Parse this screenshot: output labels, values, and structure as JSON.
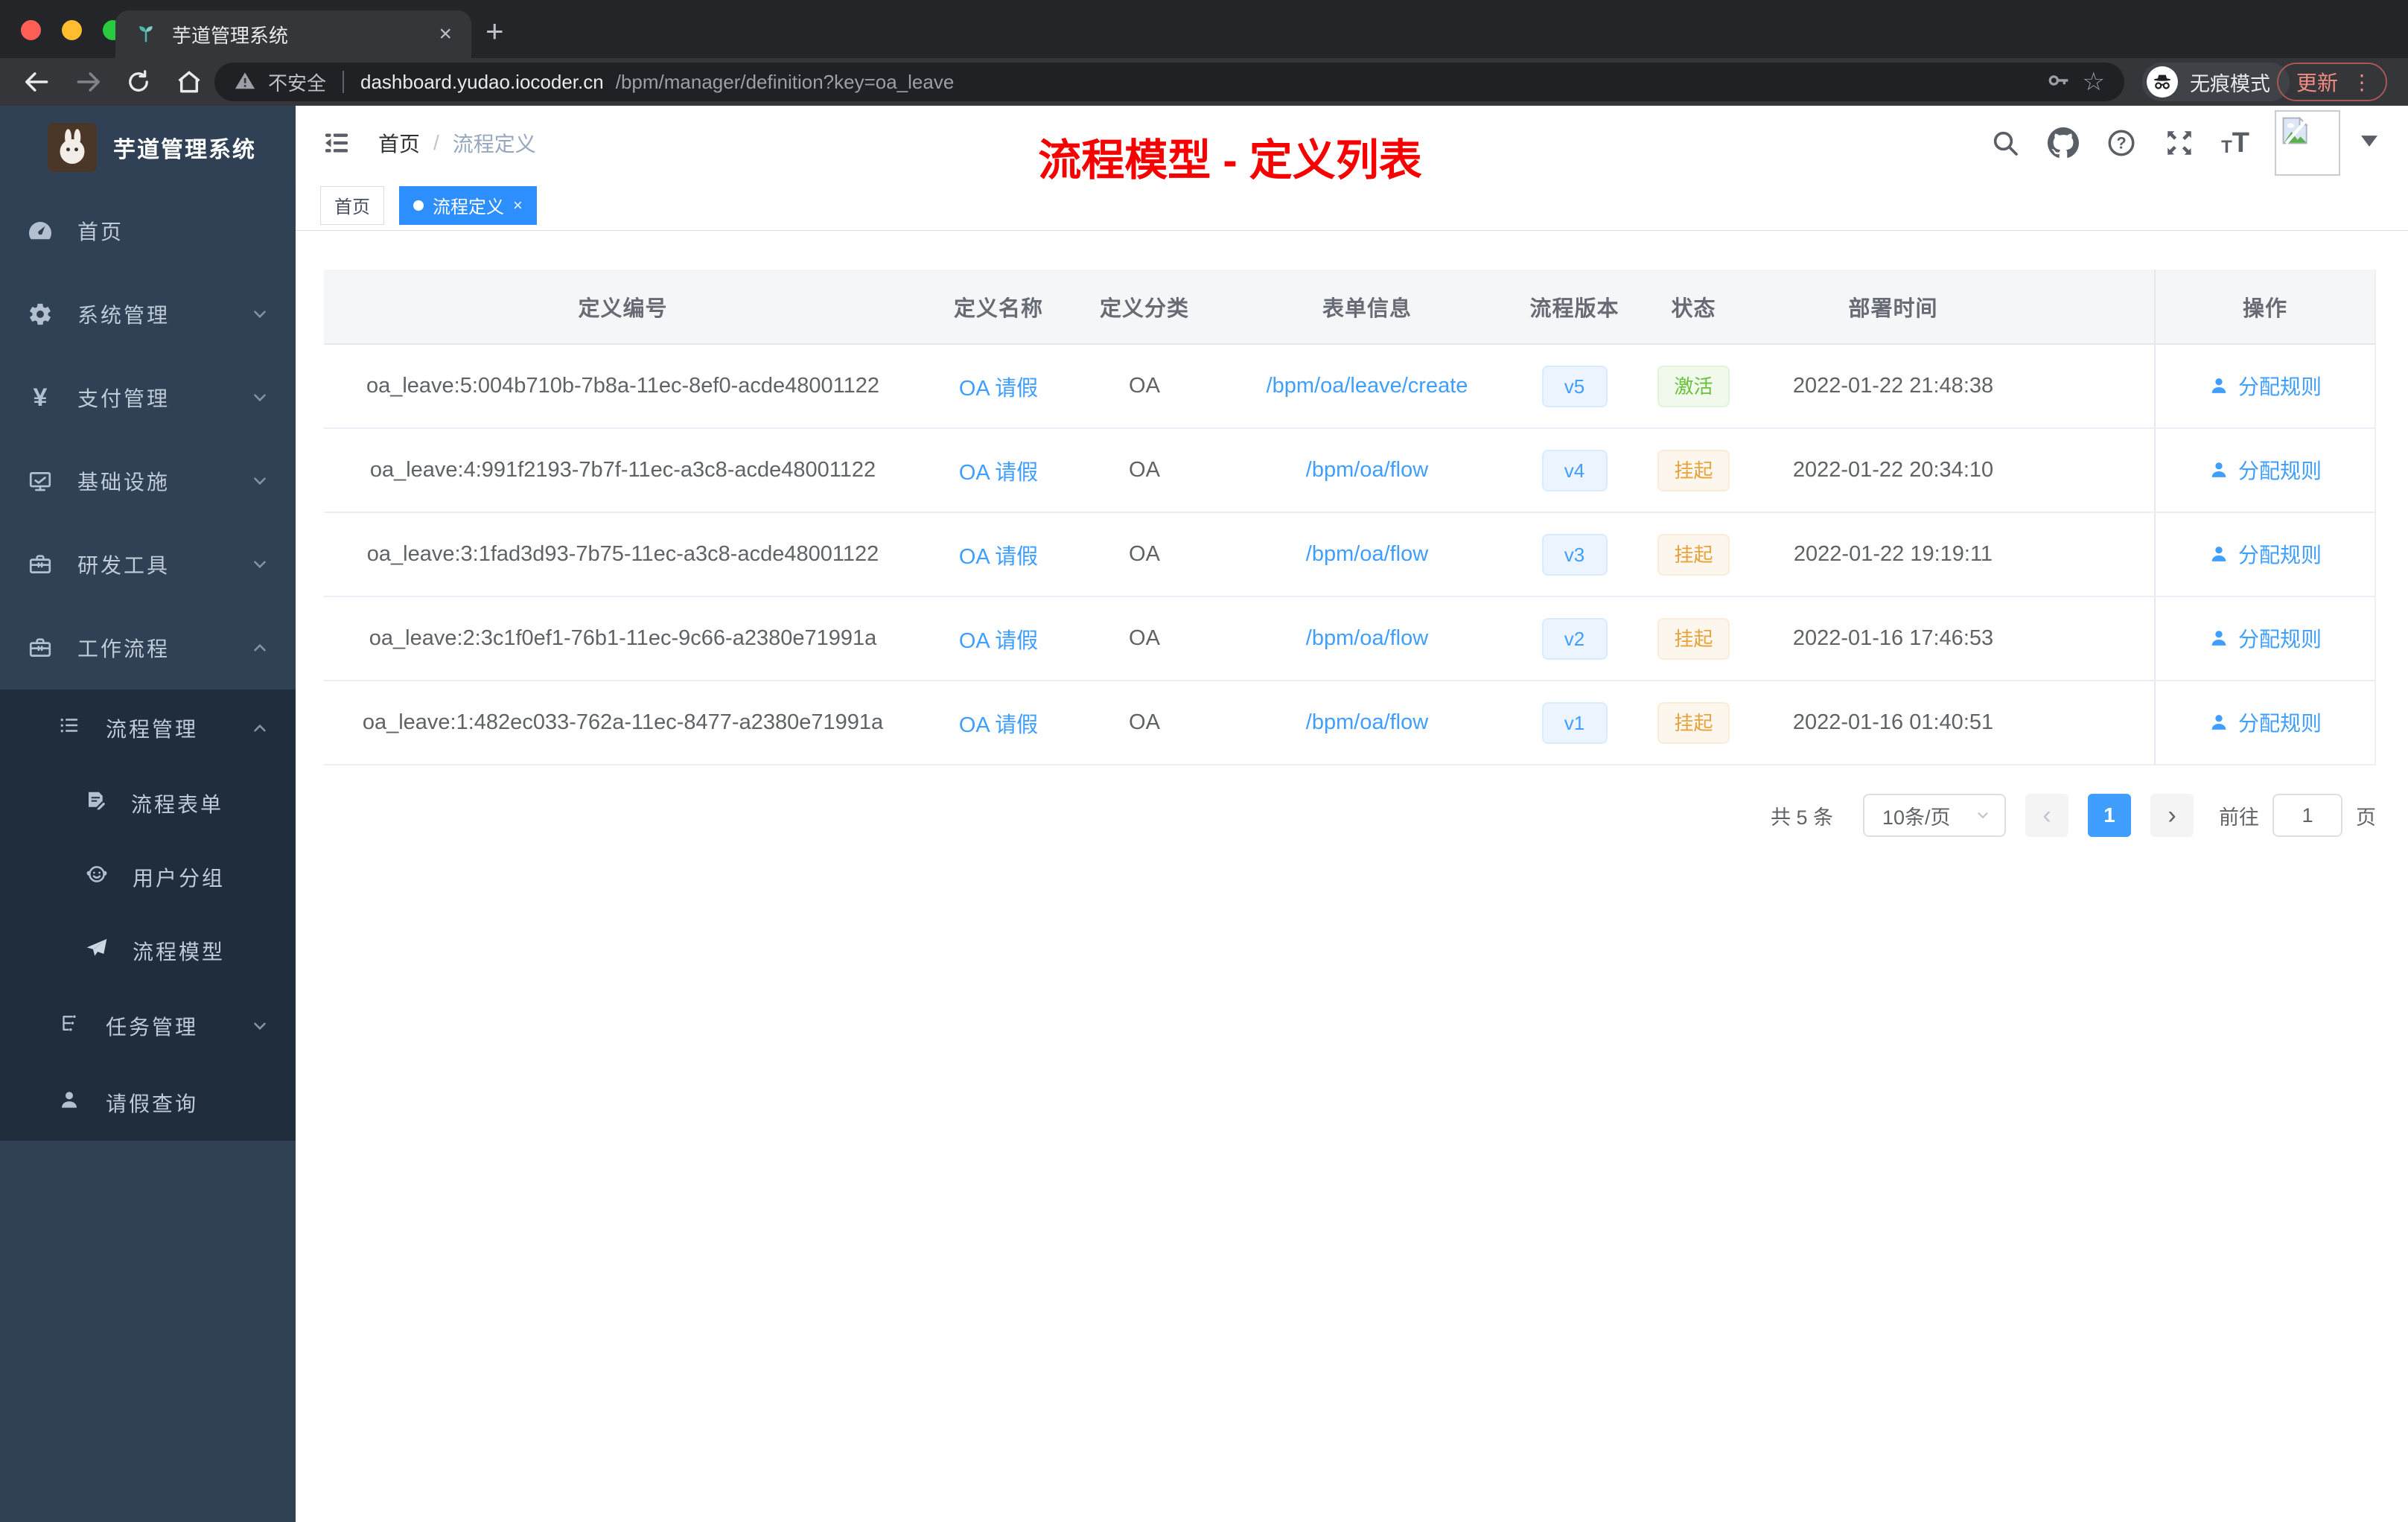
{
  "browser": {
    "tab": {
      "title": "芋道管理系统",
      "close": "×",
      "new_tab": "+"
    },
    "address": {
      "warning": "不安全",
      "host": "dashboard.yudao.iocoder.cn",
      "path": "/bpm/manager/definition?key=oa_leave"
    },
    "incognito_label": "无痕模式",
    "update_label": "更新",
    "menu_dots": "⋮",
    "star": "☆"
  },
  "sidebar": {
    "title": "芋道管理系统",
    "items": [
      {
        "label": "首页"
      },
      {
        "label": "系统管理"
      },
      {
        "label": "支付管理"
      },
      {
        "label": "基础设施"
      },
      {
        "label": "研发工具"
      },
      {
        "label": "工作流程"
      }
    ],
    "submenu": {
      "group": {
        "label": "流程管理"
      },
      "children": [
        {
          "label": "流程表单"
        },
        {
          "label": "用户分组"
        },
        {
          "label": "流程模型"
        }
      ],
      "siblings": [
        {
          "label": "任务管理"
        },
        {
          "label": "请假查询"
        }
      ]
    }
  },
  "header": {
    "breadcrumb": {
      "home": "首页",
      "separator": "/",
      "current": "流程定义"
    },
    "annotation": "流程模型 - 定义列表"
  },
  "tags": {
    "home": "首页",
    "active": "流程定义",
    "close": "×"
  },
  "table": {
    "columns": [
      "定义编号",
      "定义名称",
      "定义分类",
      "表单信息",
      "流程版本",
      "状态",
      "部署时间",
      "操作"
    ],
    "rows": [
      {
        "id": "oa_leave:5:004b710b-7b8a-11ec-8ef0-acde48001122",
        "name": "OA 请假",
        "category": "OA",
        "form": "/bpm/oa/leave/create",
        "version": "v5",
        "status": "激活",
        "status_type": "success",
        "deploy_time": "2022-01-22 21:48:38",
        "action": "分配规则"
      },
      {
        "id": "oa_leave:4:991f2193-7b7f-11ec-a3c8-acde48001122",
        "name": "OA 请假",
        "category": "OA",
        "form": "/bpm/oa/flow",
        "version": "v4",
        "status": "挂起",
        "status_type": "warning",
        "deploy_time": "2022-01-22 20:34:10",
        "action": "分配规则"
      },
      {
        "id": "oa_leave:3:1fad3d93-7b75-11ec-a3c8-acde48001122",
        "name": "OA 请假",
        "category": "OA",
        "form": "/bpm/oa/flow",
        "version": "v3",
        "status": "挂起",
        "status_type": "warning",
        "deploy_time": "2022-01-22 19:19:11",
        "action": "分配规则"
      },
      {
        "id": "oa_leave:2:3c1f0ef1-76b1-11ec-9c66-a2380e71991a",
        "name": "OA 请假",
        "category": "OA",
        "form": "/bpm/oa/flow",
        "version": "v2",
        "status": "挂起",
        "status_type": "warning",
        "deploy_time": "2022-01-16 17:46:53",
        "action": "分配规则"
      },
      {
        "id": "oa_leave:1:482ec033-762a-11ec-8477-a2380e71991a",
        "name": "OA 请假",
        "category": "OA",
        "form": "/bpm/oa/flow",
        "version": "v1",
        "status": "挂起",
        "status_type": "warning",
        "deploy_time": "2022-01-16 01:40:51",
        "action": "分配规则"
      }
    ]
  },
  "pagination": {
    "total": "共 5 条",
    "page_size": "10条/页",
    "prev": "‹",
    "current_page": "1",
    "next": "›",
    "goto_label": "前往",
    "goto_value": "1",
    "goto_unit": "页"
  },
  "colors": {
    "accent": "#409eff",
    "annotation_red": "#f70000",
    "success": "#67c23a",
    "warning": "#e6a23c",
    "sidebar_bg": "#304156",
    "submenu_bg": "#1f2d3d"
  }
}
